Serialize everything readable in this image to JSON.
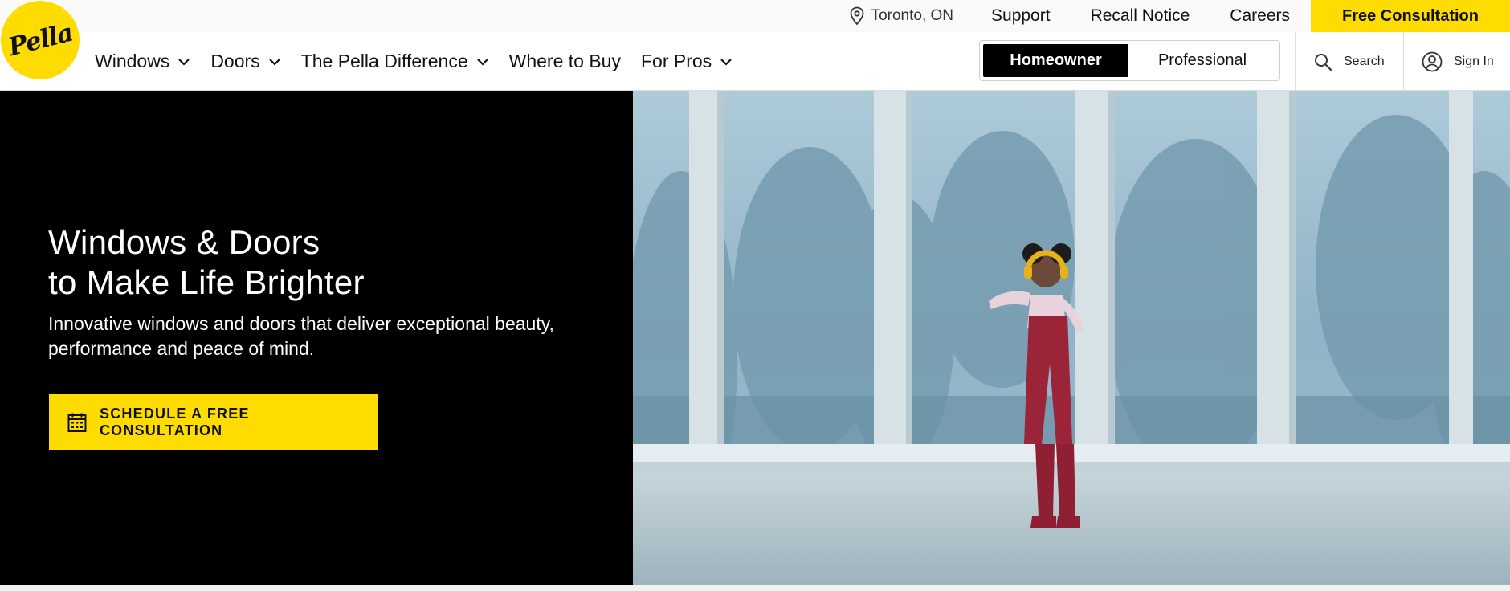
{
  "utility_bar": {
    "location": "Toronto, ON",
    "links": [
      "Support",
      "Recall Notice",
      "Careers"
    ],
    "cta": "Free Consultation"
  },
  "logo": {
    "text": "Pella"
  },
  "nav": {
    "items": [
      {
        "label": "Windows",
        "has_dropdown": true
      },
      {
        "label": "Doors",
        "has_dropdown": true
      },
      {
        "label": "The Pella Difference",
        "has_dropdown": true
      },
      {
        "label": "Where to Buy",
        "has_dropdown": false
      },
      {
        "label": "For Pros",
        "has_dropdown": true
      }
    ],
    "audience": {
      "active": "Homeowner",
      "inactive": "Professional"
    },
    "search_label": "Search",
    "signin_label": "Sign In"
  },
  "hero": {
    "title_line1": "Windows & Doors",
    "title_line2": "to Make Life Brighter",
    "subtitle": "Innovative windows and doors that deliver exceptional beauty, performance and peace of mind.",
    "cta_label": "SCHEDULE A FREE CONSULTATION",
    "media_icon": "video-still-girl-dancing-by-window"
  },
  "colors": {
    "brand_yellow": "#ffdc00",
    "hero_bg": "#000000",
    "toggle_active": "#000000"
  }
}
